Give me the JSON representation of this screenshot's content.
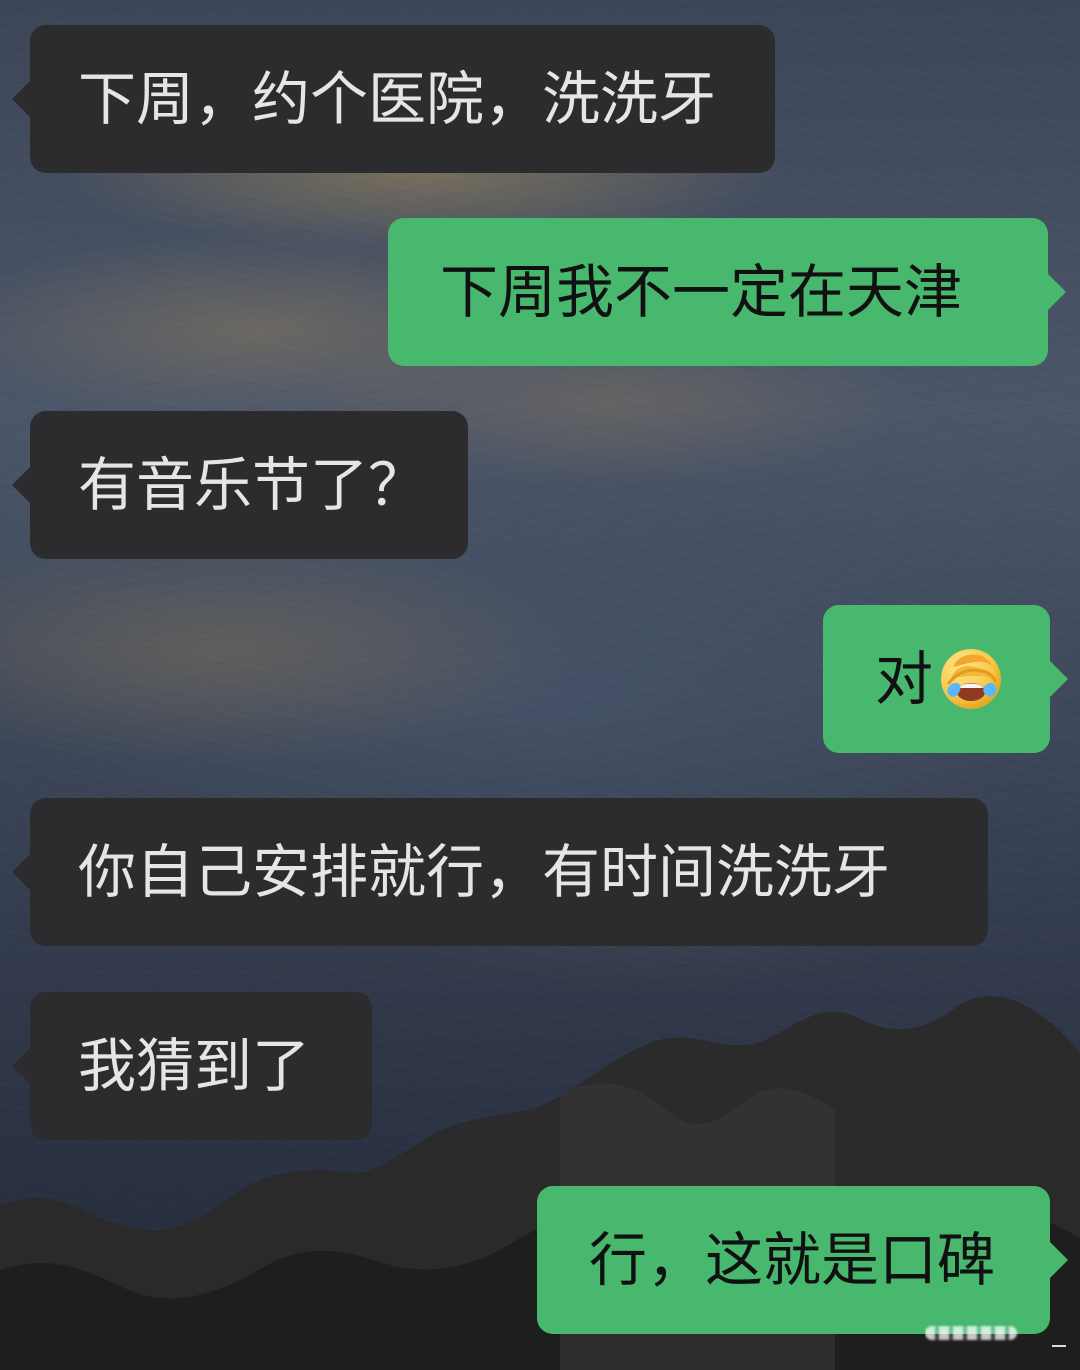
{
  "messages": [
    {
      "side": "left",
      "text": "下周，约个医院，洗洗牙"
    },
    {
      "side": "right",
      "text": "下周我不一定在天津"
    },
    {
      "side": "left",
      "text": "有音乐节了？"
    },
    {
      "side": "right",
      "text": "对",
      "emoji": "facepalm-crying-emoji"
    },
    {
      "side": "left",
      "text": "你自己安排就行，有时间洗洗牙"
    },
    {
      "side": "left",
      "text": "我猜到了"
    },
    {
      "side": "right",
      "text": "行，这就是口碑"
    }
  ],
  "colors": {
    "incoming_bubble": "#2c2c2e",
    "outgoing_bubble": "#48b86f",
    "incoming_text": "#e5e5e5",
    "outgoing_text": "#111111"
  }
}
